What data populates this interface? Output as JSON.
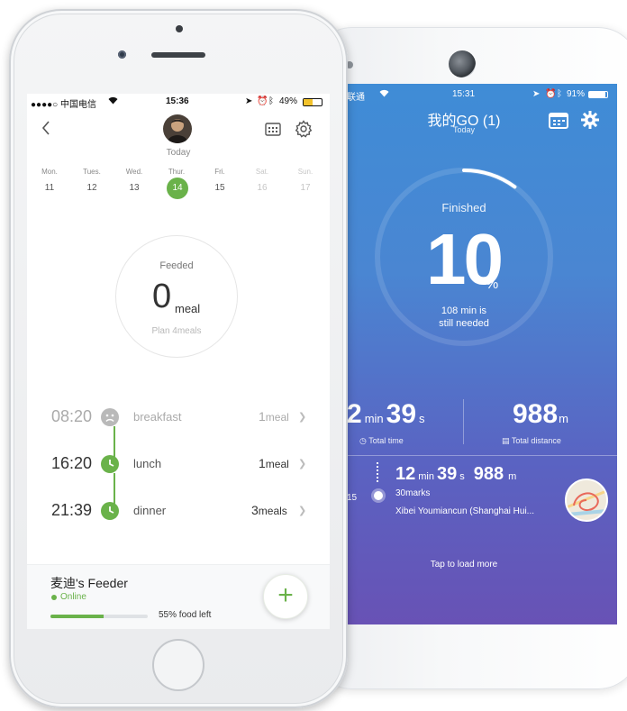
{
  "back_app": {
    "status": {
      "carrier": "联通",
      "time": "15:31",
      "battery": "91%"
    },
    "title": "我的GO (1)",
    "subtitle": "Today",
    "progress_label": "Finished",
    "progress_value": "10",
    "progress_unit": "%",
    "progress_fraction": 0.1,
    "remaining_text": "108 min is",
    "remaining_text2": "still needed",
    "total_time": {
      "min_value": "2",
      "min_unit": "min",
      "sec_value": "39",
      "sec_unit": "s",
      "label": "Total time"
    },
    "total_distance": {
      "value": "988",
      "unit": "m",
      "label": "Total distance"
    },
    "record": {
      "date_fragment": "15",
      "min_value": "12",
      "min_unit": "min",
      "sec_value": "39",
      "sec_unit": "s",
      "distance_value": "988",
      "distance_unit": "m",
      "marks": "30marks",
      "location": "Xibei Youmiancun (Shanghai Hui..."
    },
    "load_more": "Tap to load more",
    "accent": "#4a86d2"
  },
  "front_app": {
    "status": {
      "carrier": "●●●●○ 中国电信",
      "time": "15:36",
      "battery": "49%"
    },
    "header": {
      "today_label": "Today"
    },
    "week": [
      {
        "name": "Mon.",
        "num": "11",
        "state": "past"
      },
      {
        "name": "Tues.",
        "num": "12",
        "state": "past"
      },
      {
        "name": "Wed.",
        "num": "13",
        "state": "past"
      },
      {
        "name": "Thur.",
        "num": "14",
        "state": "today"
      },
      {
        "name": "Fri.",
        "num": "15",
        "state": "future"
      },
      {
        "name": "Sat.",
        "num": "16",
        "state": "dim"
      },
      {
        "name": "Sun.",
        "num": "17",
        "state": "dim"
      }
    ],
    "summary": {
      "label": "Feeded",
      "value": "0",
      "unit": "meal",
      "plan": "Plan 4meals"
    },
    "meals": [
      {
        "time": "08:20",
        "name": "breakfast",
        "qty": "1",
        "unit": "meal",
        "status": "missed"
      },
      {
        "time": "16:20",
        "name": "lunch",
        "qty": "1",
        "unit": "meal",
        "status": "scheduled"
      },
      {
        "time": "21:39",
        "name": "dinner",
        "qty": "3",
        "unit": "meals",
        "status": "scheduled"
      }
    ],
    "feeder": {
      "name": "麦迪's Feeder",
      "status": "Online",
      "food_left_text": "55% food left",
      "food_left_fraction": 0.55
    },
    "fab_label": "+",
    "accent": "#6ab24a"
  }
}
